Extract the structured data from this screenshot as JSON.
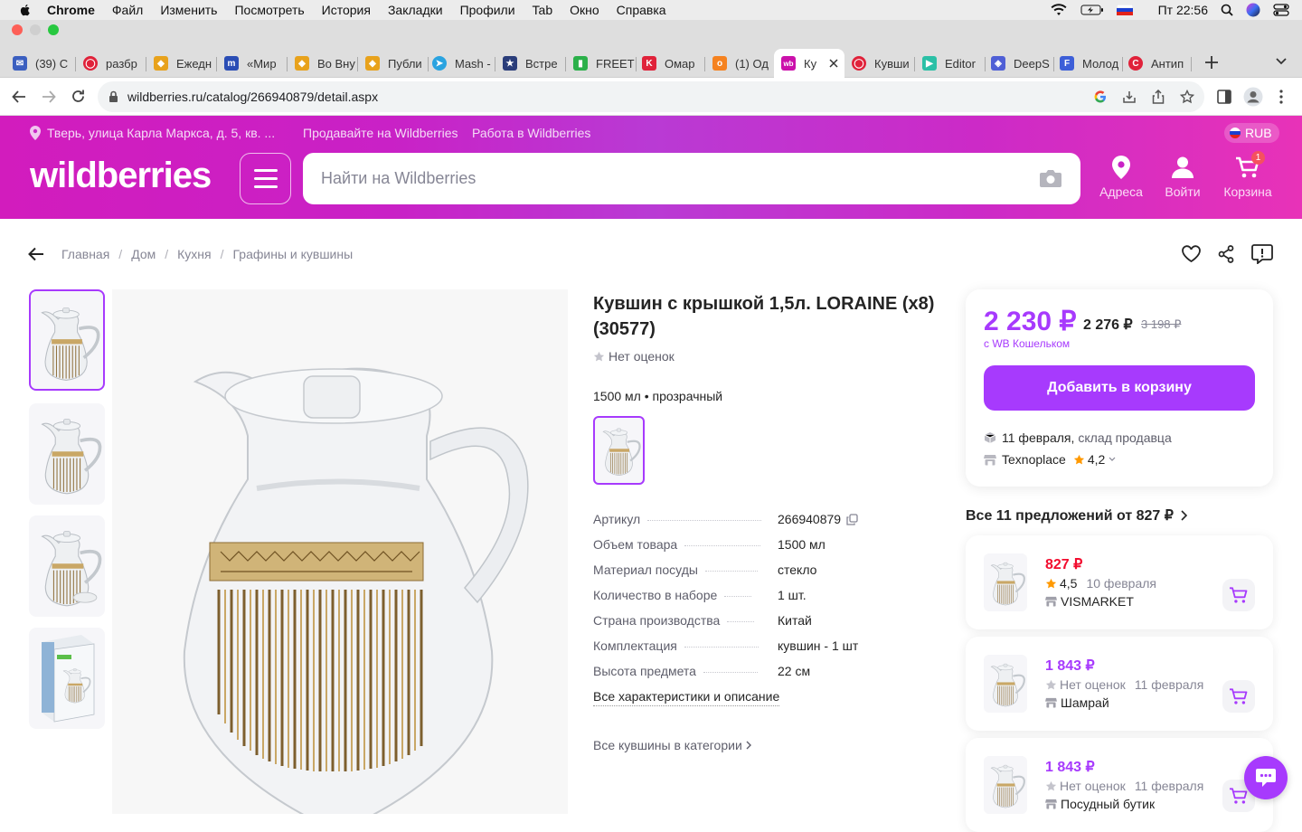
{
  "menubar": {
    "app_name": "Chrome",
    "items": [
      "Файл",
      "Изменить",
      "Посмотреть",
      "История",
      "Закладки",
      "Профили",
      "Tab",
      "Окно",
      "Справка"
    ],
    "clock": "Пт 22:56"
  },
  "tabs": [
    {
      "title": "(39) С",
      "icon": "mail-icon",
      "color": "#3b5fc0"
    },
    {
      "title": "разбр",
      "icon": "circle-logo-icon",
      "color": "#e0223a"
    },
    {
      "title": "Ежедн",
      "icon": "shield-icon",
      "color": "#e8a21c"
    },
    {
      "title": "«Мир",
      "icon": "m-logo-icon",
      "color": "#2a4db5"
    },
    {
      "title": "Во Вну",
      "icon": "shield-icon",
      "color": "#e8a21c"
    },
    {
      "title": "Публи",
      "icon": "shield-icon",
      "color": "#e8a21c"
    },
    {
      "title": "Mash -",
      "icon": "telegram-icon",
      "color": "#2aa3e0"
    },
    {
      "title": "Встре",
      "icon": "badge-icon",
      "color": "#2a3d7a"
    },
    {
      "title": "FREET",
      "icon": "bars-icon",
      "color": "#2bb04a"
    },
    {
      "title": "Омар",
      "icon": "k-logo-icon",
      "color": "#e0223a"
    },
    {
      "title": "(1) Од",
      "icon": "ok-icon",
      "color": "#f58220"
    },
    {
      "title": "Ку",
      "icon": "wb-icon",
      "color": "#cb11ab",
      "active": true
    },
    {
      "title": "Кувши",
      "icon": "circle-logo-icon",
      "color": "#e0223a"
    },
    {
      "title": "Editor",
      "icon": "play-icon",
      "color": "#2bc0a6"
    },
    {
      "title": "DeepS",
      "icon": "deep-icon",
      "color": "#4f5fd6"
    },
    {
      "title": "Молод",
      "icon": "f-logo-icon",
      "color": "#3d5fd8"
    },
    {
      "title": "Антип",
      "icon": "c-logo-icon",
      "color": "#e0223a"
    }
  ],
  "address": {
    "url": "wildberries.ru/catalog/266940879/detail.aspx"
  },
  "header": {
    "location": "Тверь, улица Карла Маркса, д. 5, кв. ...",
    "sell_link": "Продавайте на Wildberries",
    "work_link": "Работа в Wildberries",
    "currency": "RUB",
    "logo": "wildberries",
    "search_placeholder": "Найти на Wildberries",
    "nav_addresses": "Адреса",
    "nav_login": "Войти",
    "nav_cart": "Корзина",
    "cart_count": "1"
  },
  "breadcrumbs": [
    "Главная",
    "Дом",
    "Кухня",
    "Графины и кувшины"
  ],
  "product": {
    "title": "Кувшин с крышкой 1,5л. LORAINE (х8) (30577)",
    "rating": "Нет оценок",
    "variant": "1500 мл • прозрачный",
    "specs": [
      {
        "key": "Артикул",
        "value": "266940879"
      },
      {
        "key": "Объем товара",
        "value": "1500 мл"
      },
      {
        "key": "Материал посуды",
        "value": "стекло"
      },
      {
        "key": "Количество в наборе",
        "value": "1 шт."
      },
      {
        "key": "Страна производства",
        "value": "Китай"
      },
      {
        "key": "Комплектация",
        "value": "кувшин - 1 шт"
      },
      {
        "key": "Высота предмета",
        "value": "22 см"
      }
    ],
    "all_specs_link": "Все характеристики и описание",
    "all_category_link": "Все кувшины в категории"
  },
  "price_card": {
    "price": "2 230 ₽",
    "price_old": "2 276 ₽",
    "price_strike": "3 198 ₽",
    "wallet_note": "с WB Кошельком",
    "add_button": "Добавить в корзину",
    "delivery_date": "11 февраля,",
    "delivery_note": "склад продавца",
    "seller": "Texnoplace",
    "seller_rating": "4,2"
  },
  "offers": {
    "heading": "Все 11 предложений от 827 ₽",
    "items": [
      {
        "price": "827 ₽",
        "rating": "4,5",
        "date": "10 февраля",
        "seller": "VISMARKET"
      },
      {
        "price": "1 843 ₽",
        "rating": "Нет оценок",
        "date": "11 февраля",
        "seller": "Шамрай"
      },
      {
        "price": "1 843 ₽",
        "rating": "Нет оценок",
        "date": "11 февраля",
        "seller": "Посудный бутик"
      }
    ]
  },
  "colors": {
    "accent": "#a73afd",
    "brand": "#cb11ab",
    "sale_red": "#f20c2e"
  }
}
